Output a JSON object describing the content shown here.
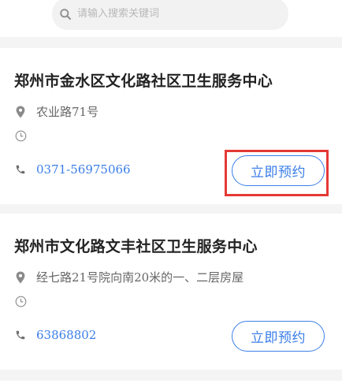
{
  "search": {
    "placeholder": "请输入搜索关键词",
    "value": ""
  },
  "centers": [
    {
      "name": "郑州市金水区文化路社区卫生服务中心",
      "address": "农业路71号",
      "hours": "",
      "phone": "0371-56975066",
      "book_label": "立即预约"
    },
    {
      "name": "郑州市文化路文丰社区卫生服务中心",
      "address": "经七路21号院向南20米的一、二层房屋",
      "hours": "",
      "phone": "63868802",
      "book_label": "立即预约"
    }
  ],
  "icons": {
    "search": "search-icon",
    "location": "location-pin-icon",
    "clock": "clock-icon",
    "phone": "phone-icon"
  },
  "colors": {
    "accent": "#3a7ee8",
    "highlight": "#e53935",
    "background": "#f4f4f4"
  }
}
